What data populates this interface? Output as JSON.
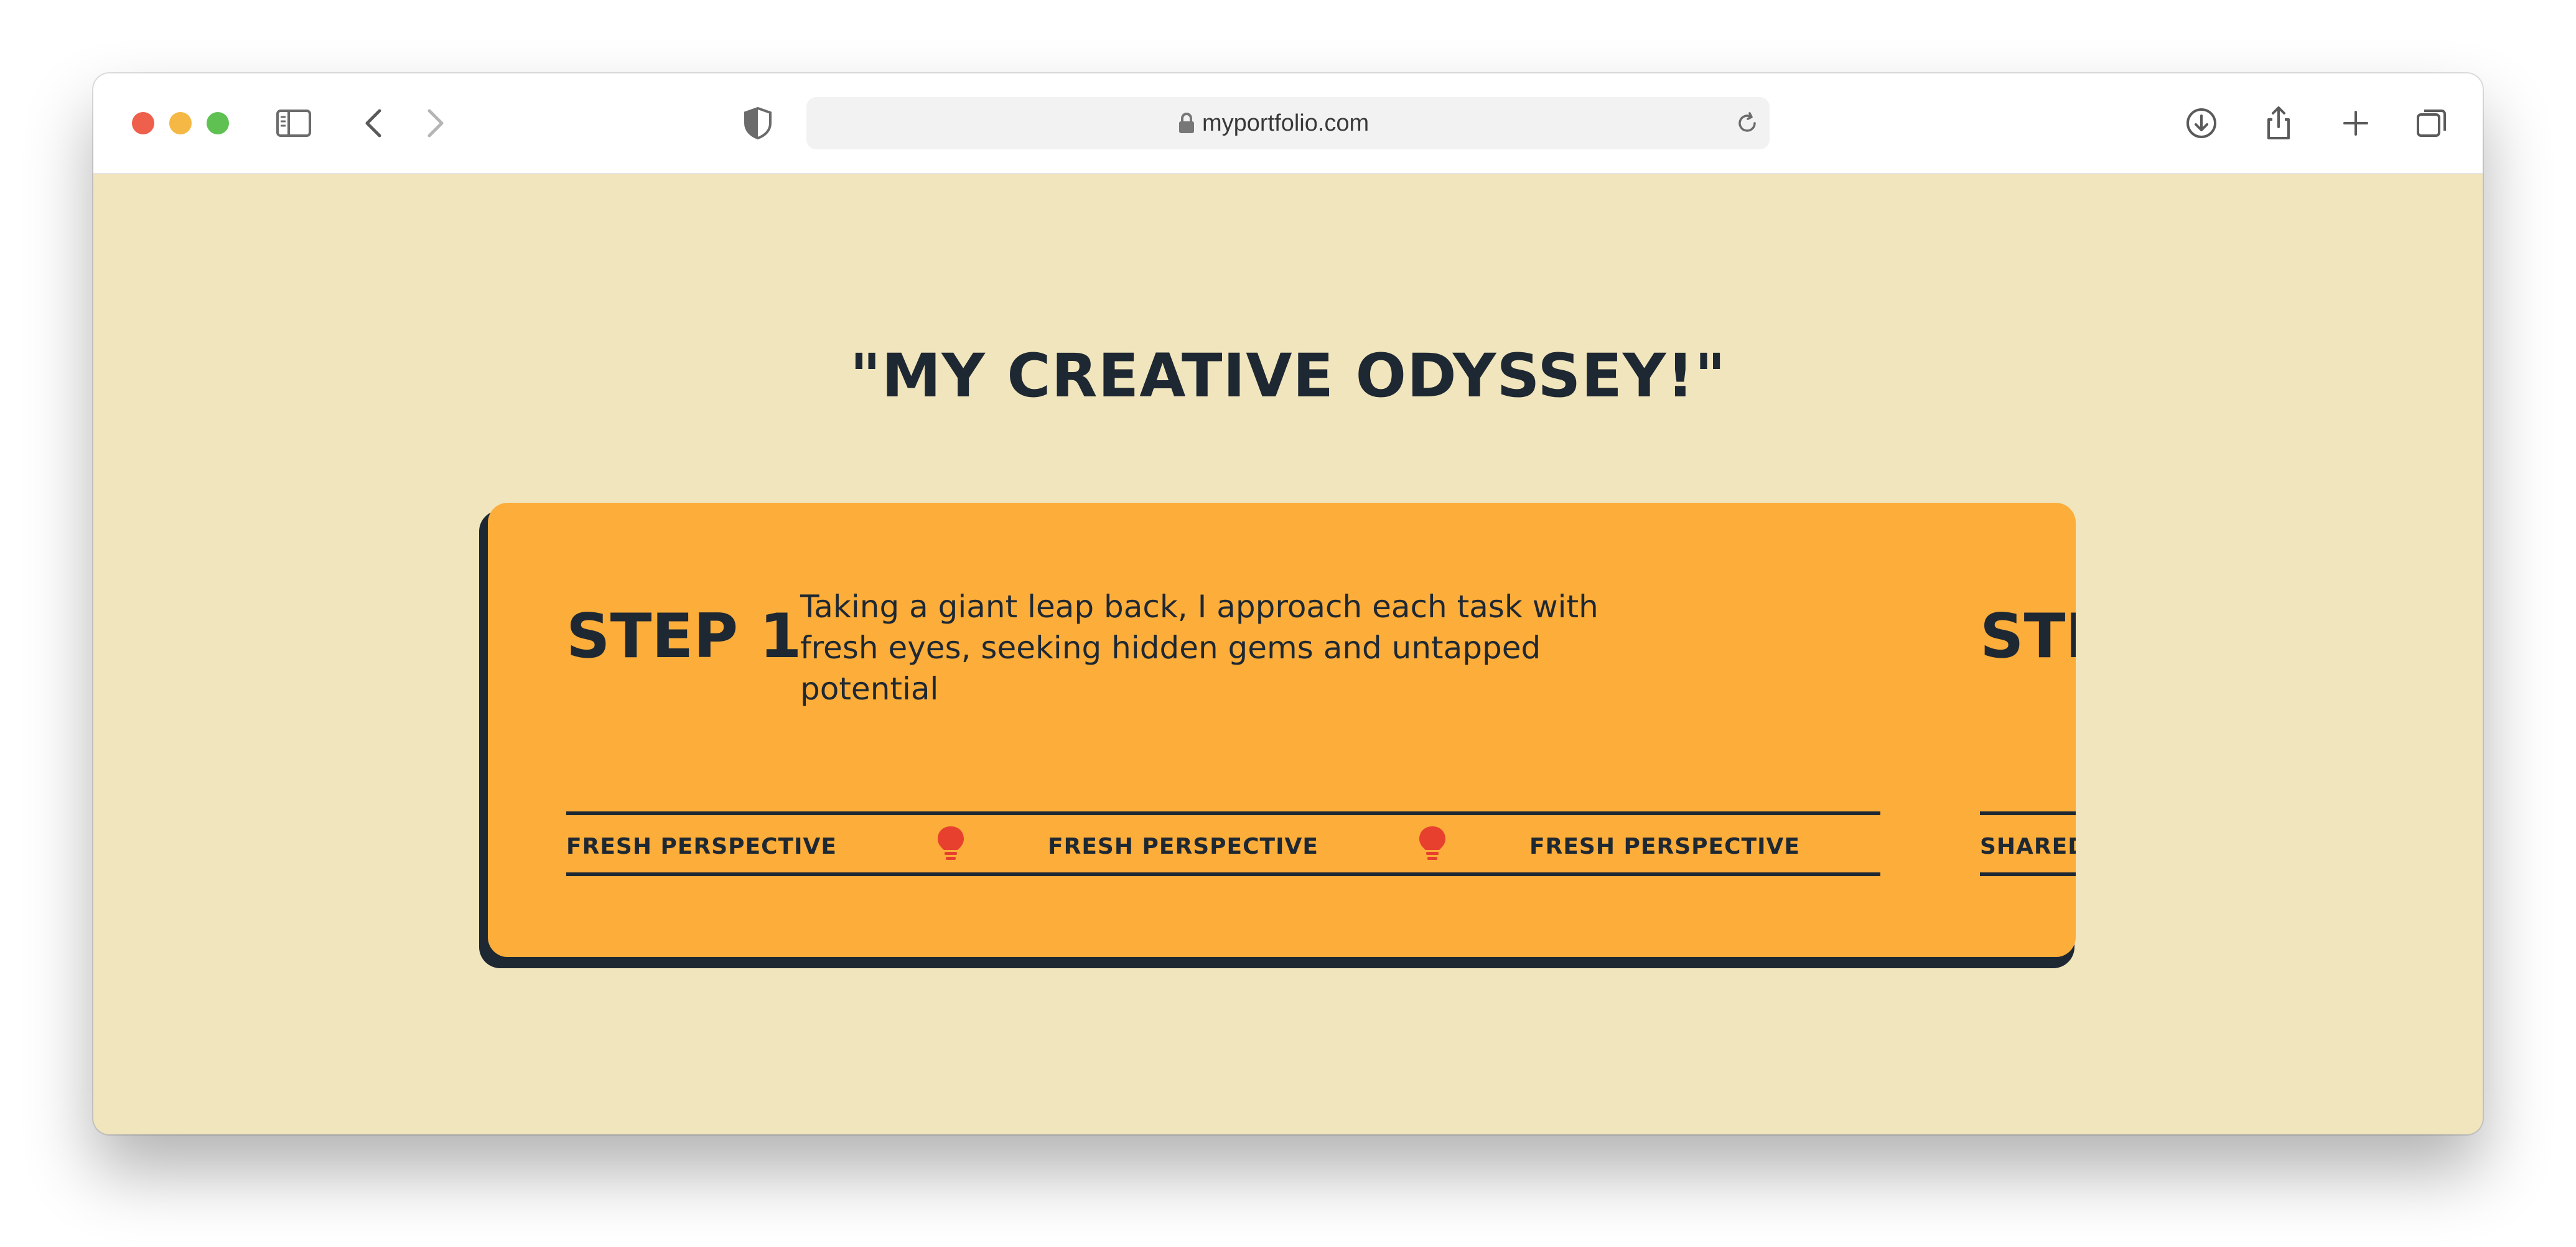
{
  "browser": {
    "url": "myportfolio.com",
    "icons": {
      "sidebar": "sidebar-icon",
      "back": "chevron-left-icon",
      "forward": "chevron-right-icon",
      "privacy": "shield-icon",
      "lock": "lock-icon",
      "reload": "reload-icon",
      "download": "download-icon",
      "share": "share-icon",
      "new_tab": "plus-icon",
      "tabs": "tabs-overview-icon"
    }
  },
  "page": {
    "title": "\"MY CREATIVE ODYSSEY!\"",
    "colors": {
      "background": "#f1e5bd",
      "card": "#fcad3a",
      "ink": "#1e2832",
      "bulb": "#e8402f"
    },
    "steps": [
      {
        "label": "STEP 1",
        "description": "Taking a giant leap back, I approach each task with fresh eyes, seeking hidden gems and untapped potential",
        "ticker": [
          "FRESH PERSPECTIVE",
          "FRESH PERSPECTIVE",
          "FRESH PERSPECTIVE"
        ]
      },
      {
        "label": "STE",
        "ticker": [
          "SHARED"
        ]
      }
    ]
  }
}
